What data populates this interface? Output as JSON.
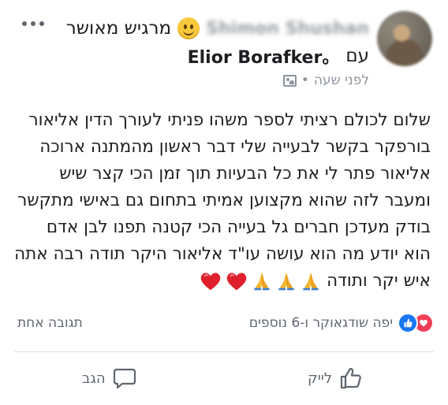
{
  "post": {
    "author_name": "Shimon Shushan",
    "feeling_text": "מרגיש מאושר",
    "with_prefix": "עם",
    "tagged_name": "Elior Borafker",
    "tagged_suffix": "。",
    "time": "לפני שעה",
    "separator": "•",
    "body_lines": [
      "שלום לכולם רציתי לספר משהו פניתי לעורך הדין אליאור",
      "בורפקר בקשר לבעייה שלי דבר ראשון מהמתנה ארוכה",
      "אליאור פתר לי את כל הבעיות תוך זמן הכי קצר שיש",
      "ומעבר לזה שהוא מקצוען אמיתי בתחום גם באישי מתקשר",
      "בודק מעדכן חברים גל בעייה הכי קטנה תפנו לבן אדם",
      "הוא יודע מה הוא עושה עו\"ד אליאור היקר תודה רבה אתה",
      "איש יקר ותודה"
    ]
  },
  "reactions": {
    "text": "יפה שודגאוקר ו-6 נוספים",
    "comments_count": "תגובה אחת"
  },
  "actions": {
    "like_label": "לייק",
    "comment_label": "הגב"
  },
  "icons": {
    "feeling": "smiling-face-icon",
    "privacy": "friends-privacy-icon",
    "more": "more-options-icon",
    "like": "thumbs-up-icon",
    "comment": "speech-bubble-icon",
    "heart": "red-heart-icon",
    "pray": "folded-hands-icon"
  },
  "colors": {
    "like_blue": "#1877f2",
    "love_red": "#f33e58",
    "meta_gray": "#606770",
    "heart_red": "#e0202c",
    "pray_yellow": "#f5b731"
  }
}
